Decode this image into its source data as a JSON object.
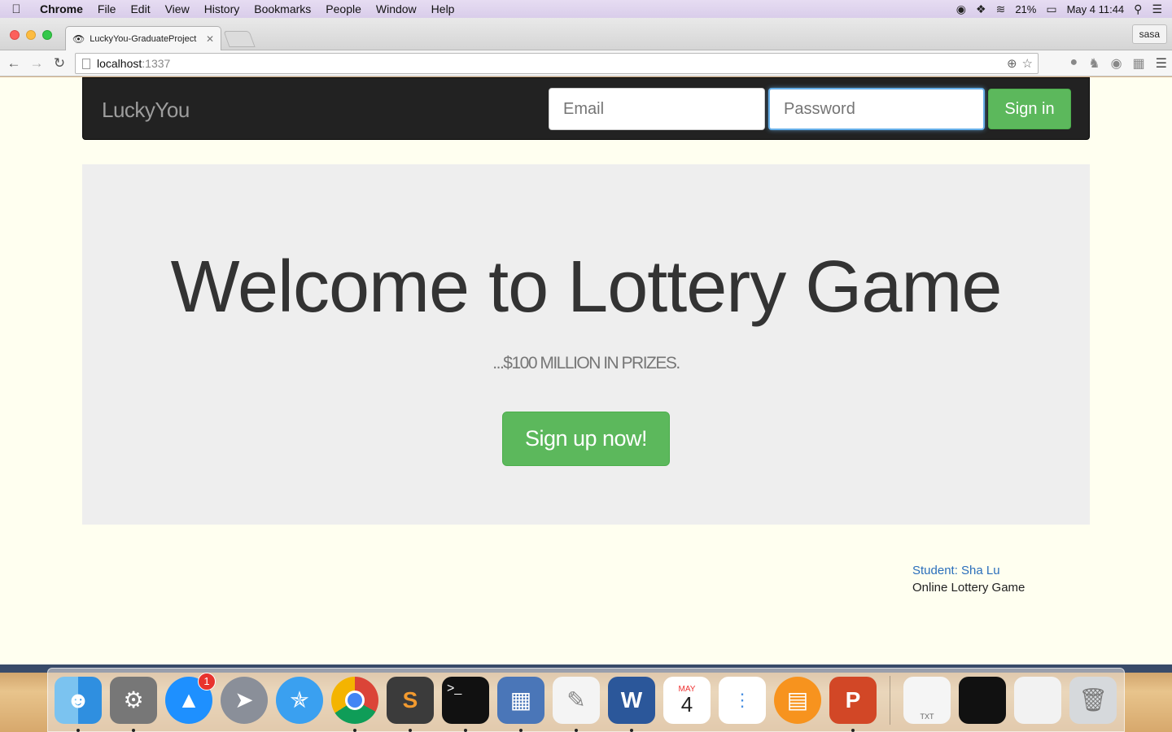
{
  "menubar": {
    "app": "Chrome",
    "items": [
      "File",
      "Edit",
      "View",
      "History",
      "Bookmarks",
      "People",
      "Window",
      "Help"
    ],
    "battery": "21%",
    "datetime": "May 4  11:44"
  },
  "browser": {
    "tab_title": "LuckyYou-GraduateProject",
    "profile": "sasa",
    "url_host": "localhost",
    "url_port": ":1337"
  },
  "site": {
    "brand": "LuckyYou",
    "email_placeholder": "Email",
    "password_placeholder": "Password",
    "signin_label": "Sign in",
    "hero_title": "Welcome to Lottery Game",
    "hero_subtitle": "...$100 MILLION IN PRIZES.",
    "signup_label": "Sign up now!",
    "footer_student": "Student: Sha Lu",
    "footer_project": "Online Lottery Game"
  },
  "dock": {
    "appstore_badge": "1",
    "calendar_month": "MAY",
    "calendar_day": "4",
    "txt_label": "TXT"
  },
  "colors": {
    "navbar": "#222222",
    "success": "#5cb85c",
    "jumbotron": "#eeeeee",
    "page_bg": "#fffff0",
    "link": "#2a6ebb"
  }
}
